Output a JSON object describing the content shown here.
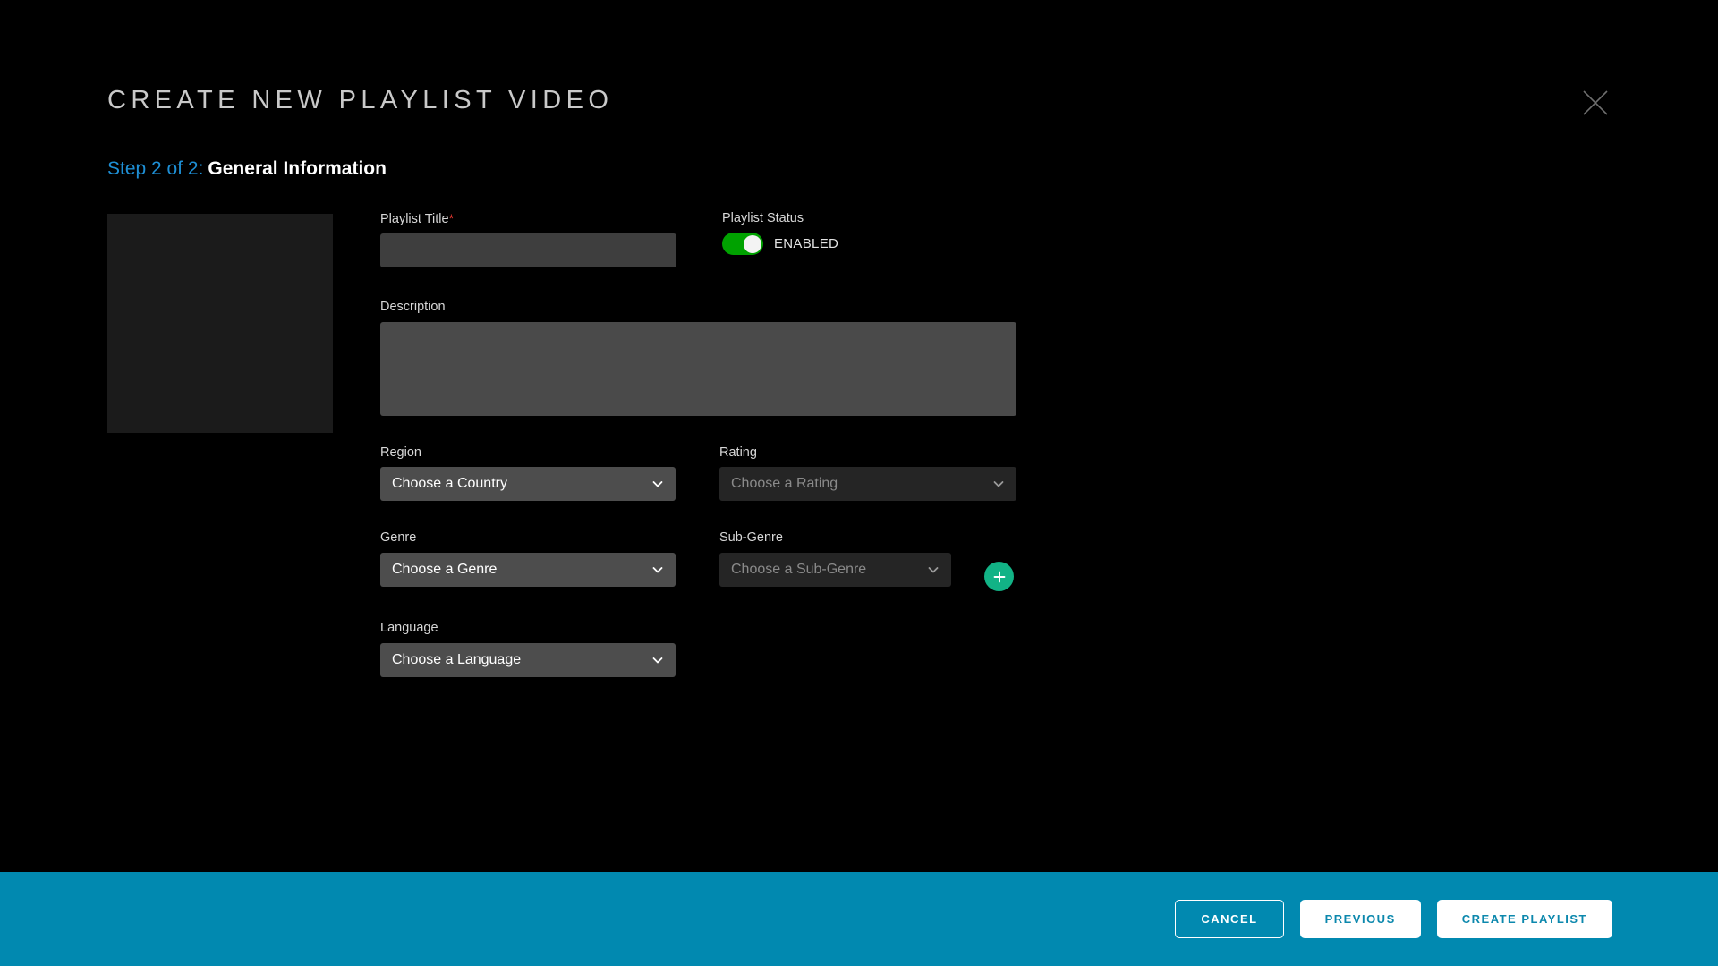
{
  "header": {
    "title": "CREATE NEW PLAYLIST VIDEO",
    "close_icon": "close-icon",
    "step_label": "Step 2 of 2:",
    "step_name": "General Information"
  },
  "thumbnail": {
    "name": "playlist-thumbnail-placeholder",
    "background": "#1b1b1b"
  },
  "form": {
    "playlist_title": {
      "label": "Playlist Title",
      "required_marker": "*",
      "value": "",
      "placeholder": ""
    },
    "playlist_status": {
      "label": "Playlist Status",
      "toggle_state": "on",
      "state_text": "ENABLED",
      "on_color": "#00a200"
    },
    "description": {
      "label": "Description",
      "value": "",
      "placeholder": ""
    },
    "region": {
      "label": "Region",
      "value": "Choose a Country",
      "enabled": true,
      "chevron_icon": "chevron-down-icon"
    },
    "rating": {
      "label": "Rating",
      "value": "Choose a Rating",
      "enabled": false,
      "chevron_icon": "chevron-down-icon"
    },
    "genre": {
      "label": "Genre",
      "value": "Choose a Genre",
      "enabled": true,
      "chevron_icon": "chevron-down-icon"
    },
    "subgenre": {
      "label": "Sub-Genre",
      "value": "Choose a Sub-Genre",
      "enabled": false,
      "chevron_icon": "chevron-down-icon"
    },
    "add_subgenre": {
      "icon": "plus-icon",
      "color": "#12b386"
    },
    "language": {
      "label": "Language",
      "value": "Choose a Language",
      "enabled": true,
      "chevron_icon": "chevron-down-icon"
    }
  },
  "footer": {
    "background": "#0189b0",
    "cancel_label": "CANCEL",
    "previous_label": "PREVIOUS",
    "create_label": "CREATE PLAYLIST"
  }
}
